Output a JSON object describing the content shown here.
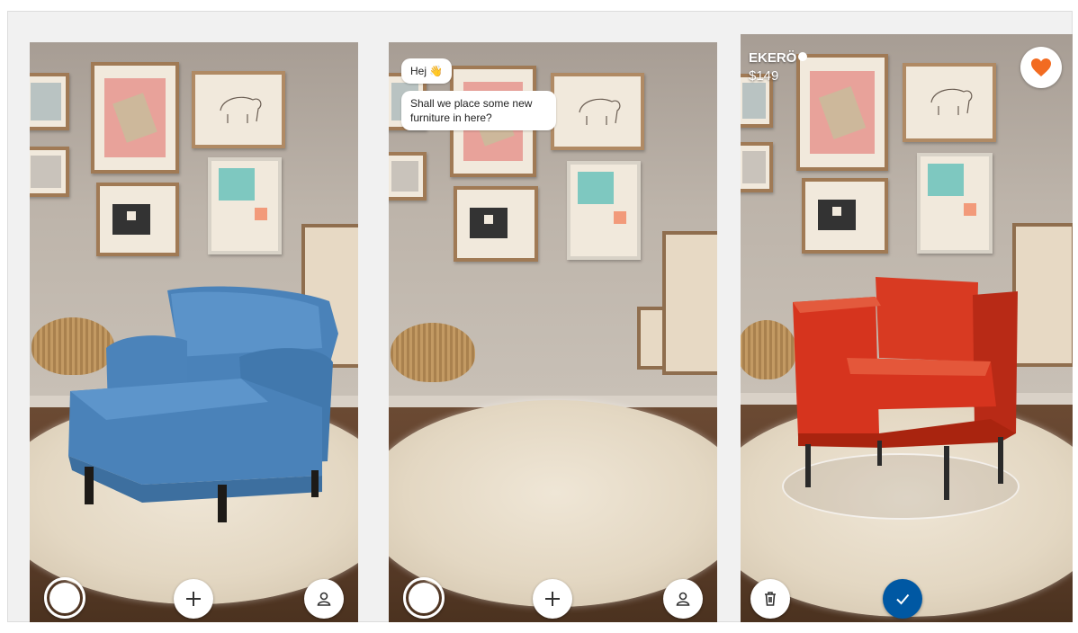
{
  "screens": [
    {
      "controls": {
        "left_icon": "capture-circle-icon",
        "center_icon": "plus-icon",
        "right_icon": "person-icon"
      },
      "furniture": {
        "color": "#4d86bd"
      }
    },
    {
      "chat": {
        "greeting": "Hej 👋",
        "message": "Shall we place some new furniture in here?"
      },
      "controls": {
        "left_icon": "capture-circle-icon",
        "center_icon": "plus-icon",
        "right_icon": "person-icon"
      }
    },
    {
      "product": {
        "name": "EKERÖ",
        "price": "$149"
      },
      "controls": {
        "left_icon": "trash-icon",
        "center_icon": "checkmark-icon"
      },
      "favorite_icon": "heart-icon",
      "furniture": {
        "color": "#d6341e"
      }
    }
  ],
  "colors": {
    "accent_blue": "#0058a3",
    "heart_orange": "#f26b21"
  }
}
